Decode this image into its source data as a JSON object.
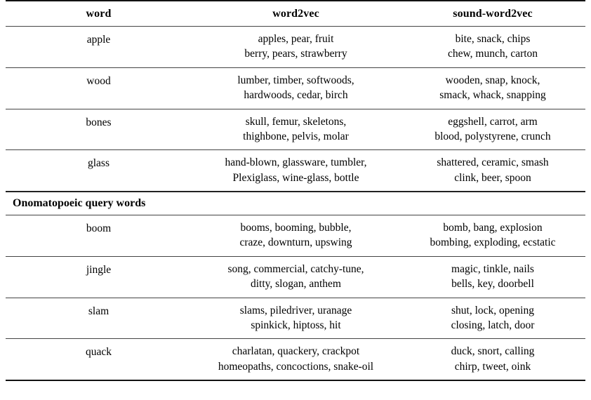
{
  "table": {
    "columns": [
      "word",
      "word2vec",
      "sound-word2vec"
    ],
    "section_header": "Onomatopoeic query words",
    "rows": [
      {
        "word": "apple",
        "word2vec": [
          "apples, pear, fruit",
          "berry, pears, strawberry"
        ],
        "sound_word2vec": [
          "bite, snack, chips",
          "chew, munch, carton"
        ]
      },
      {
        "word": "wood",
        "word2vec": [
          "lumber, timber, softwoods,",
          "hardwoods, cedar, birch"
        ],
        "sound_word2vec": [
          "wooden, snap, knock,",
          "smack, whack, snapping"
        ]
      },
      {
        "word": "bones",
        "word2vec": [
          "skull, femur, skeletons,",
          "thighbone, pelvis, molar"
        ],
        "sound_word2vec": [
          "eggshell, carrot, arm",
          "blood, polystyrene, crunch"
        ]
      },
      {
        "word": "glass",
        "word2vec": [
          "hand-blown, glassware, tumbler,",
          "Plexiglass, wine-glass, bottle"
        ],
        "sound_word2vec": [
          "shattered, ceramic, smash",
          "clink, beer, spoon"
        ]
      },
      {
        "word": "boom",
        "word2vec": [
          "booms, booming, bubble,",
          "craze, downturn, upswing"
        ],
        "sound_word2vec": [
          "bomb, bang, explosion",
          "bombing, exploding, ecstatic"
        ]
      },
      {
        "word": "jingle",
        "word2vec": [
          "song, commercial, catchy-tune,",
          "ditty, slogan, anthem"
        ],
        "sound_word2vec": [
          "magic, tinkle, nails",
          "bells, key, doorbell"
        ]
      },
      {
        "word": "slam",
        "word2vec": [
          "slams, piledriver, uranage",
          "spinkick, hiptoss, hit"
        ],
        "sound_word2vec": [
          "shut, lock, opening",
          "closing, latch, door"
        ]
      },
      {
        "word": "quack",
        "word2vec": [
          "charlatan, quackery, crackpot",
          "homeopaths, concoctions, snake-oil"
        ],
        "sound_word2vec": [
          "duck, snort, calling",
          "chirp, tweet, oink"
        ]
      }
    ]
  }
}
